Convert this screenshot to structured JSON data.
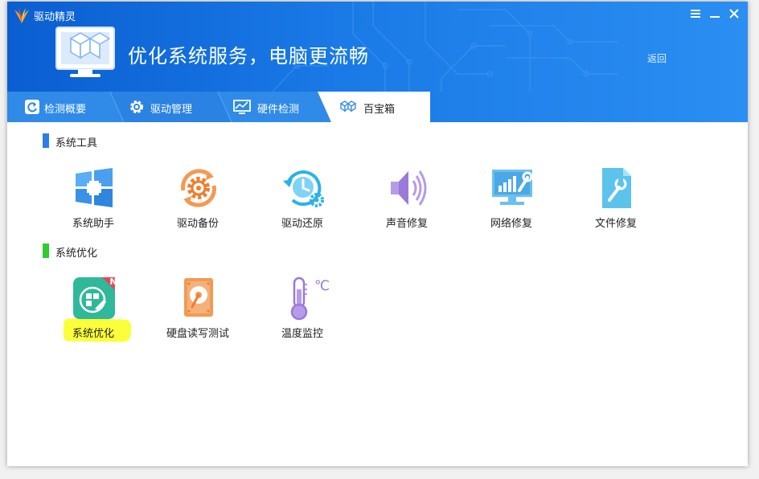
{
  "window": {
    "app_title": "驱动精灵",
    "hero_text": "优化系统服务，电脑更流畅",
    "back_label": "返回",
    "controls": [
      "menu",
      "minimize",
      "close"
    ]
  },
  "tabs": [
    {
      "label": "检测概要",
      "icon": "refresh-icon",
      "active": false
    },
    {
      "label": "驱动管理",
      "icon": "gear-icon",
      "active": false
    },
    {
      "label": "硬件检测",
      "icon": "monitor-chart-icon",
      "active": false
    },
    {
      "label": "百宝箱",
      "icon": "toolbox-icon",
      "active": true
    }
  ],
  "sections": [
    {
      "title": "系统工具",
      "accent": "#2f7de1",
      "items": [
        {
          "label": "系统助手",
          "icon": "windows-plus-icon"
        },
        {
          "label": "驱动备份",
          "icon": "gear-refresh-icon"
        },
        {
          "label": "驱动还原",
          "icon": "clock-restore-icon"
        },
        {
          "label": "声音修复",
          "icon": "speaker-icon"
        },
        {
          "label": "网络修复",
          "icon": "network-repair-icon"
        },
        {
          "label": "文件修复",
          "icon": "file-repair-icon"
        }
      ]
    },
    {
      "title": "系统优化",
      "accent": "#2ecc2e",
      "items": [
        {
          "label": "系统优化",
          "icon": "rocket-optimize-icon",
          "badge": "N",
          "highlighted": true
        },
        {
          "label": "硬盘读写测试",
          "icon": "hard-disk-icon"
        },
        {
          "label": "温度监控",
          "icon": "thermometer-icon",
          "unit": "℃"
        }
      ]
    }
  ],
  "colors": {
    "header_start": "#0a5ed1",
    "header_end": "#2a8ef2",
    "tab_active": "#ffffff",
    "highlight": "#fbff3a"
  }
}
